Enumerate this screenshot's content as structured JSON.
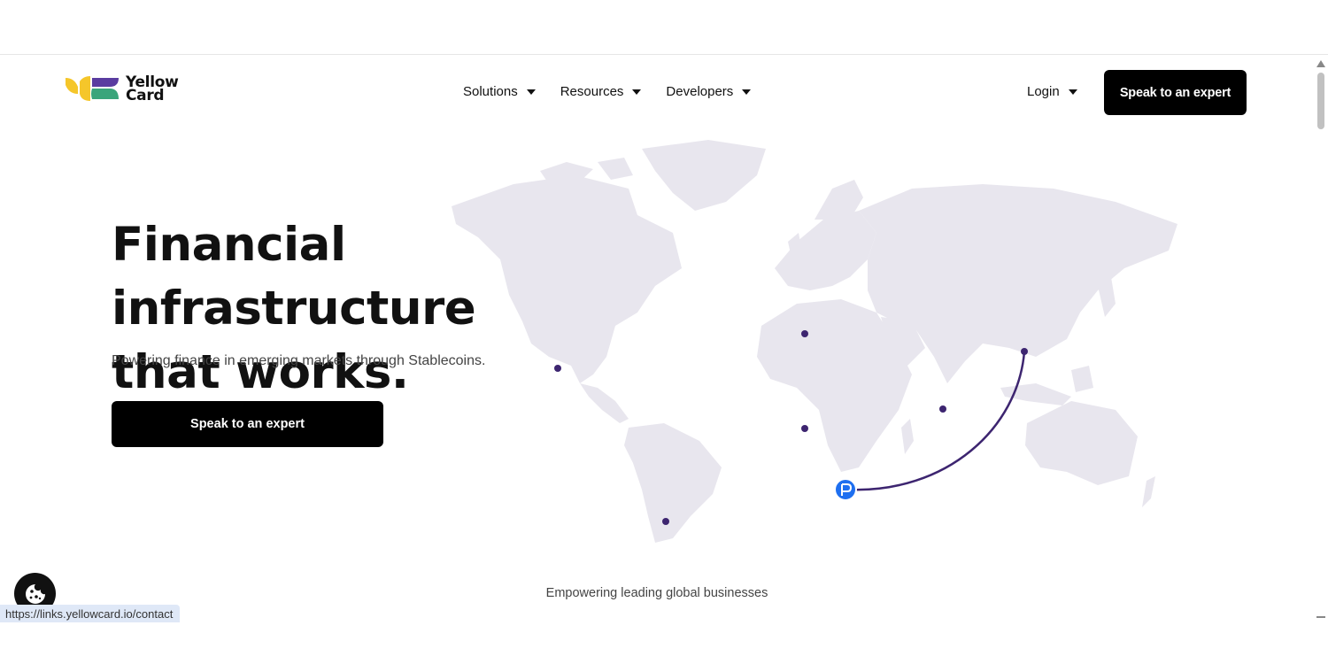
{
  "header": {
    "logo_line1": "Yellow",
    "logo_line2": "Card",
    "nav": [
      {
        "label": "Solutions"
      },
      {
        "label": "Resources"
      },
      {
        "label": "Developers"
      }
    ],
    "login_label": "Login",
    "cta_label": "Speak to an expert"
  },
  "hero": {
    "title_line1": "Financial infrastructure",
    "title_line2": "that works.",
    "subtitle": "Powering finance in emerging markets through Stablecoins.",
    "cta_label": "Speak to an expert"
  },
  "map": {
    "land_color": "#e8e6ee",
    "dot_color": "#3d2570",
    "arc_color": "#3d2570",
    "badge_icon": "paypal-icon",
    "badge_color": "#1e6ff0"
  },
  "footer": {
    "empower_text": "Empowering leading global businesses"
  },
  "status_bar": {
    "url": "https://links.yellowcard.io/contact"
  },
  "cookie_button": {
    "icon": "cookie-icon"
  },
  "colors": {
    "primary_button": "#000000",
    "logo_yellow": "#f5c62a",
    "logo_purple": "#5a3ca0",
    "logo_green": "#3aa57b"
  }
}
